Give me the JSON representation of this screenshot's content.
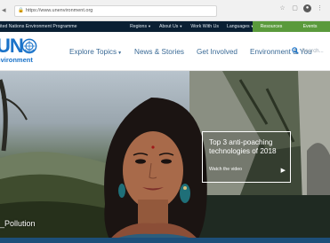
{
  "browser": {
    "url": "https://www.unenvironment.org",
    "nav_glyph": "◂"
  },
  "topbar": {
    "org": "ited Nations Environment Programme",
    "links": [
      {
        "label": "Regions",
        "has_dropdown": true
      },
      {
        "label": "About Us",
        "has_dropdown": true
      },
      {
        "label": "Work With Us",
        "has_dropdown": false
      },
      {
        "label": "Languages",
        "has_dropdown": true
      }
    ],
    "resources": "Resources",
    "events": "Events",
    "green": "#5a9a3c",
    "bg": "#0a1f33"
  },
  "logo": {
    "un": "UN",
    "env": "nvironment",
    "color": "#1a73c9"
  },
  "nav": {
    "items": [
      {
        "label": "Explore Topics",
        "has_dropdown": true
      },
      {
        "label": "News & Stories",
        "has_dropdown": false
      },
      {
        "label": "Get Involved",
        "has_dropdown": false
      },
      {
        "label": "Environment & You",
        "has_dropdown": false
      }
    ],
    "search_placeholder": "Search..."
  },
  "hero": {
    "caption": "_Pollution",
    "promo_title": "Top 3 anti-poaching technologies of 2018",
    "promo_link": "Watch the video",
    "promo_arrow": "▶"
  }
}
